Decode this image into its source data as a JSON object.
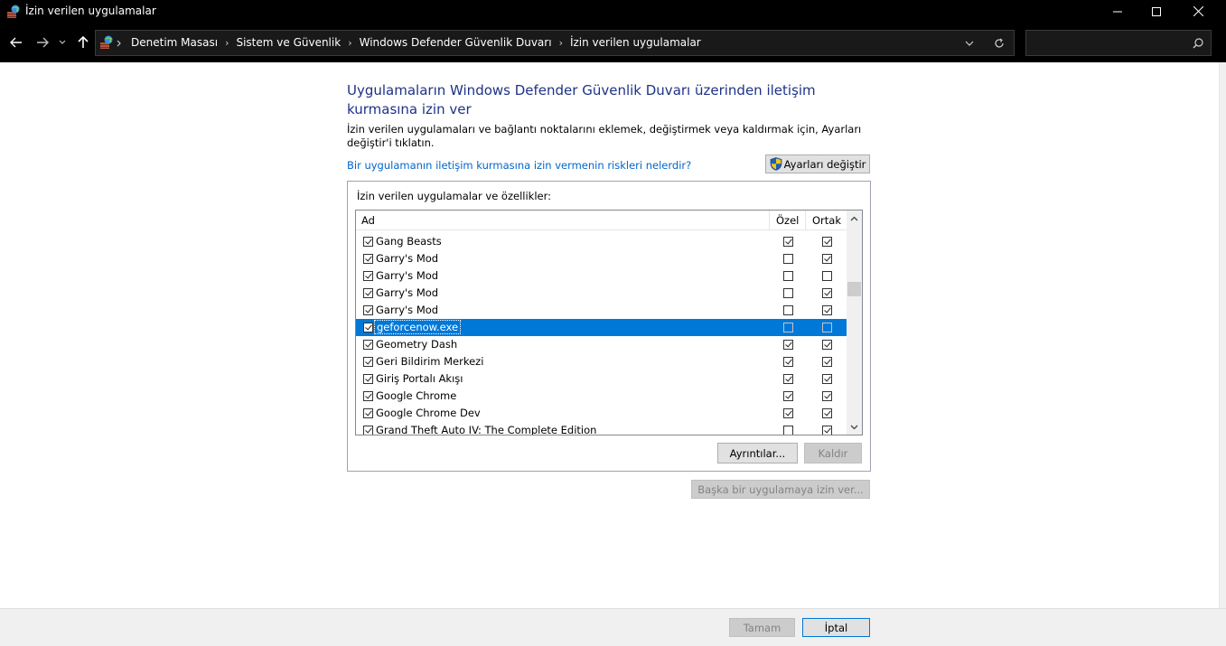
{
  "window": {
    "title": "İzin verilen uygulamalar"
  },
  "address": {
    "crumbs": [
      "Denetim Masası",
      "Sistem ve Güvenlik",
      "Windows Defender Güvenlik Duvarı",
      "İzin verilen uygulamalar"
    ],
    "search_placeholder": ""
  },
  "main": {
    "heading": "Uygulamaların Windows Defender Güvenlik Duvarı üzerinden iletişim kurmasına izin ver",
    "description": "İzin verilen uygulamaları ve bağlantı noktalarını eklemek, değiştirmek veya kaldırmak için, Ayarları değiştir'i tıklatın.",
    "risk_link": "Bir uygulamanın iletişim kurmasına izin vermenin riskleri nelerdir?",
    "change_settings_label": "Ayarları değiştir",
    "group_label": "İzin verilen uygulamalar ve özellikler:",
    "columns": {
      "name": "Ad",
      "private": "Özel",
      "public": "Ortak"
    },
    "rows": [
      {
        "name": "Gang Beasts",
        "enabled": true,
        "private": true,
        "public": true,
        "selected": false
      },
      {
        "name": "Garry's Mod",
        "enabled": true,
        "private": false,
        "public": true,
        "selected": false
      },
      {
        "name": "Garry's Mod",
        "enabled": true,
        "private": false,
        "public": false,
        "selected": false
      },
      {
        "name": "Garry's Mod",
        "enabled": true,
        "private": false,
        "public": true,
        "selected": false
      },
      {
        "name": "Garry's Mod",
        "enabled": true,
        "private": false,
        "public": true,
        "selected": false
      },
      {
        "name": "geforcenow.exe",
        "enabled": true,
        "private": false,
        "public": false,
        "selected": true
      },
      {
        "name": "Geometry Dash",
        "enabled": true,
        "private": true,
        "public": true,
        "selected": false
      },
      {
        "name": "Geri Bildirim Merkezi",
        "enabled": true,
        "private": true,
        "public": true,
        "selected": false
      },
      {
        "name": "Giriş Portalı Akışı",
        "enabled": true,
        "private": true,
        "public": true,
        "selected": false
      },
      {
        "name": "Google Chrome",
        "enabled": true,
        "private": true,
        "public": true,
        "selected": false
      },
      {
        "name": "Google Chrome Dev",
        "enabled": true,
        "private": true,
        "public": true,
        "selected": false
      },
      {
        "name": "Grand Theft Auto IV: The Complete Edition",
        "enabled": true,
        "private": false,
        "public": true,
        "selected": false
      }
    ],
    "details_label": "Ayrıntılar...",
    "remove_label": "Kaldır",
    "allow_another_label": "Başka bir uygulamaya izin ver..."
  },
  "footer": {
    "ok_label": "Tamam",
    "cancel_label": "İptal"
  },
  "colors": {
    "heading": "#1e3287",
    "link": "#0066cc",
    "selection": "#0078d7",
    "titlebar": "#000000"
  }
}
